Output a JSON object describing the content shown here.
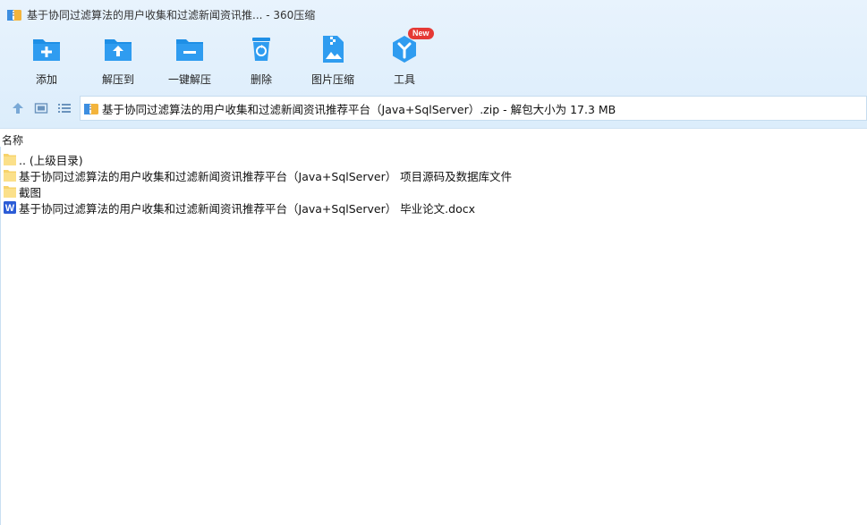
{
  "window": {
    "title": "基于协同过滤算法的用户收集和过滤新闻资讯推... - 360压缩"
  },
  "toolbar": {
    "items": [
      {
        "label": "添加",
        "icon": "add-folder-icon"
      },
      {
        "label": "解压到",
        "icon": "extract-to-icon"
      },
      {
        "label": "一键解压",
        "icon": "one-click-extract-icon"
      },
      {
        "label": "删除",
        "icon": "recycle-bin-icon"
      },
      {
        "label": "图片压缩",
        "icon": "image-compress-icon"
      },
      {
        "label": "工具",
        "icon": "tools-icon",
        "badge": "New"
      }
    ]
  },
  "nav": {
    "path": "基于协同过滤算法的用户收集和过滤新闻资讯推荐平台（Java+SqlServer）.zip - 解包大小为 17.3 MB"
  },
  "list": {
    "column_name": "名称",
    "rows": [
      {
        "name": ".. (上级目录)",
        "icon": "folder-icon"
      },
      {
        "name": "基于协同过滤算法的用户收集和过滤新闻资讯推荐平台（Java+SqlServer） 项目源码及数据库文件",
        "icon": "folder-icon"
      },
      {
        "name": "截图",
        "icon": "folder-icon"
      },
      {
        "name": "基于协同过滤算法的用户收集和过滤新闻资讯推荐平台（Java+SqlServer） 毕业论文.docx",
        "icon": "word-doc-icon"
      }
    ]
  },
  "colors": {
    "accent": "#1e8fe6",
    "badge": "#e53935",
    "folder": "#f7d36b"
  }
}
